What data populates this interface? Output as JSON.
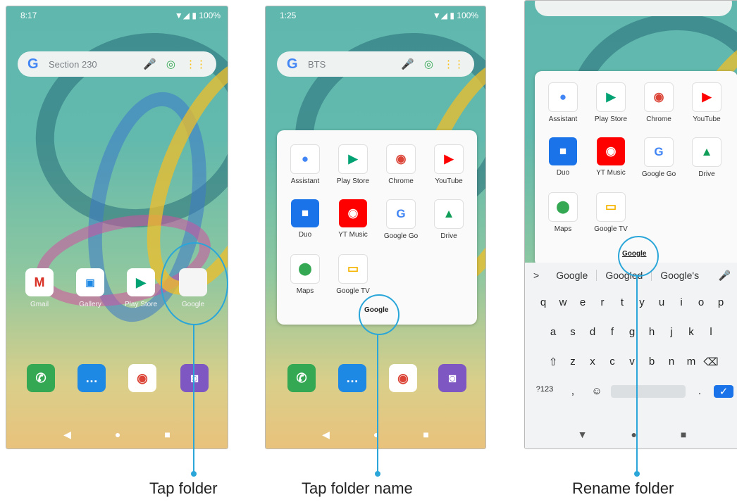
{
  "screen1": {
    "time": "8:17",
    "status_icons": "▼◢ ▮ 100%",
    "search_text": "Section 230",
    "home_apps": [
      "Gmail",
      "Gallery",
      "Play Store",
      "Google"
    ],
    "dock_apps": [
      "Phone",
      "Messages",
      "Chrome",
      "Camera"
    ],
    "caption": "Tap folder"
  },
  "screen2": {
    "time": "1:25",
    "status_icons": "▼◢ ▮ 100%",
    "search_text": "BTS",
    "folder_apps": [
      "Assistant",
      "Play Store",
      "Chrome",
      "YouTube",
      "Duo",
      "YT Music",
      "Google Go",
      "Drive",
      "Maps",
      "Google TV"
    ],
    "folder_name": "Google",
    "caption": "Tap folder name"
  },
  "screen3": {
    "folder_apps": [
      "Assistant",
      "Play Store",
      "Chrome",
      "YouTube",
      "Duo",
      "YT Music",
      "Google Go",
      "Drive",
      "Maps",
      "Google TV"
    ],
    "folder_name": "Google",
    "suggestions": [
      "Google",
      "Googled",
      "Google's"
    ],
    "keyboard_rows": [
      [
        "q",
        "w",
        "e",
        "r",
        "t",
        "y",
        "u",
        "i",
        "o",
        "p"
      ],
      [
        "a",
        "s",
        "d",
        "f",
        "g",
        "h",
        "j",
        "k",
        "l"
      ],
      [
        "⇧",
        "z",
        "x",
        "c",
        "v",
        "b",
        "n",
        "m",
        "⌫"
      ],
      [
        "?123",
        ",",
        "☺",
        " ",
        ".",
        "✓"
      ]
    ],
    "caption": "Rename folder"
  },
  "icons": {
    "search_g": "G",
    "mic": "🎤",
    "lens": "◎",
    "grid": "⋮⋮",
    "back": "◀",
    "home": "●",
    "recents": "■",
    "chevron": ">",
    "kb_mic": "🎤",
    "nav_down": "▼"
  },
  "colors": {
    "accent": "#2aa6d9"
  }
}
